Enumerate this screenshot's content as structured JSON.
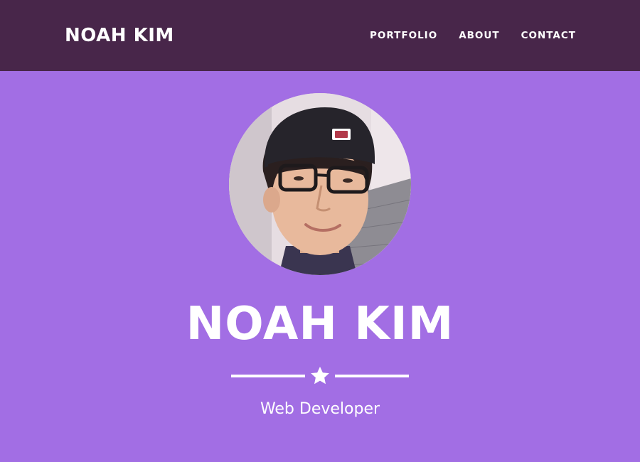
{
  "navbar": {
    "brand": "NOAH KIM",
    "links": [
      "PORTFOLIO",
      "ABOUT",
      "CONTACT"
    ]
  },
  "hero": {
    "name": "NOAH KIM",
    "subtitle": "Web Developer"
  },
  "colors": {
    "navbar_bg": "#48264a",
    "hero_bg": "#a26ee4",
    "text": "#ffffff"
  },
  "icons": {
    "divider_icon": "star-icon"
  }
}
